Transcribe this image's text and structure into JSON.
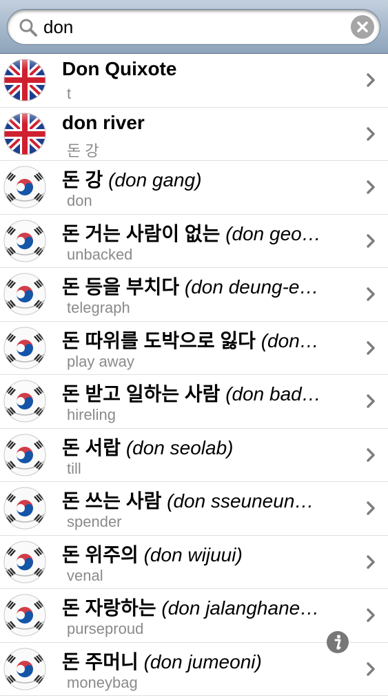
{
  "search": {
    "value": "don"
  },
  "results": [
    {
      "flag": "uk-flag-icon",
      "headword": "Don Quixote",
      "romanization": "",
      "translation": "t"
    },
    {
      "flag": "uk-flag-icon",
      "headword": "don river",
      "romanization": "",
      "translation": "돈 강"
    },
    {
      "flag": "korea-flag-icon",
      "headword": "돈 강",
      "romanization": "(don gang)",
      "translation": "don"
    },
    {
      "flag": "korea-flag-icon",
      "headword": "돈 거는 사람이 없는",
      "romanization": "(don geo…",
      "translation": "unbacked"
    },
    {
      "flag": "korea-flag-icon",
      "headword": "돈 등을 부치다",
      "romanization": "(don deung-e…",
      "translation": "telegraph"
    },
    {
      "flag": "korea-flag-icon",
      "headword": "돈 따위를 도박으로 잃다",
      "romanization": "(don…",
      "translation": "play away"
    },
    {
      "flag": "korea-flag-icon",
      "headword": "돈 받고 일하는 사람",
      "romanization": "(don bad…",
      "translation": "hireling"
    },
    {
      "flag": "korea-flag-icon",
      "headword": "돈 서랍",
      "romanization": "(don seolab)",
      "translation": "till"
    },
    {
      "flag": "korea-flag-icon",
      "headword": "돈 쓰는 사람",
      "romanization": "(don sseuneun…",
      "translation": "spender"
    },
    {
      "flag": "korea-flag-icon",
      "headword": "돈 위주의",
      "romanization": "(don wijuui)",
      "translation": "venal"
    },
    {
      "flag": "korea-flag-icon",
      "headword": "돈 자랑하는",
      "romanization": "(don jalanghane…",
      "translation": "purseproud"
    },
    {
      "flag": "korea-flag-icon",
      "headword": "돈 주머니",
      "romanization": "(don jumeoni)",
      "translation": "moneybag"
    }
  ],
  "info_button": {
    "icon": "info-icon"
  }
}
